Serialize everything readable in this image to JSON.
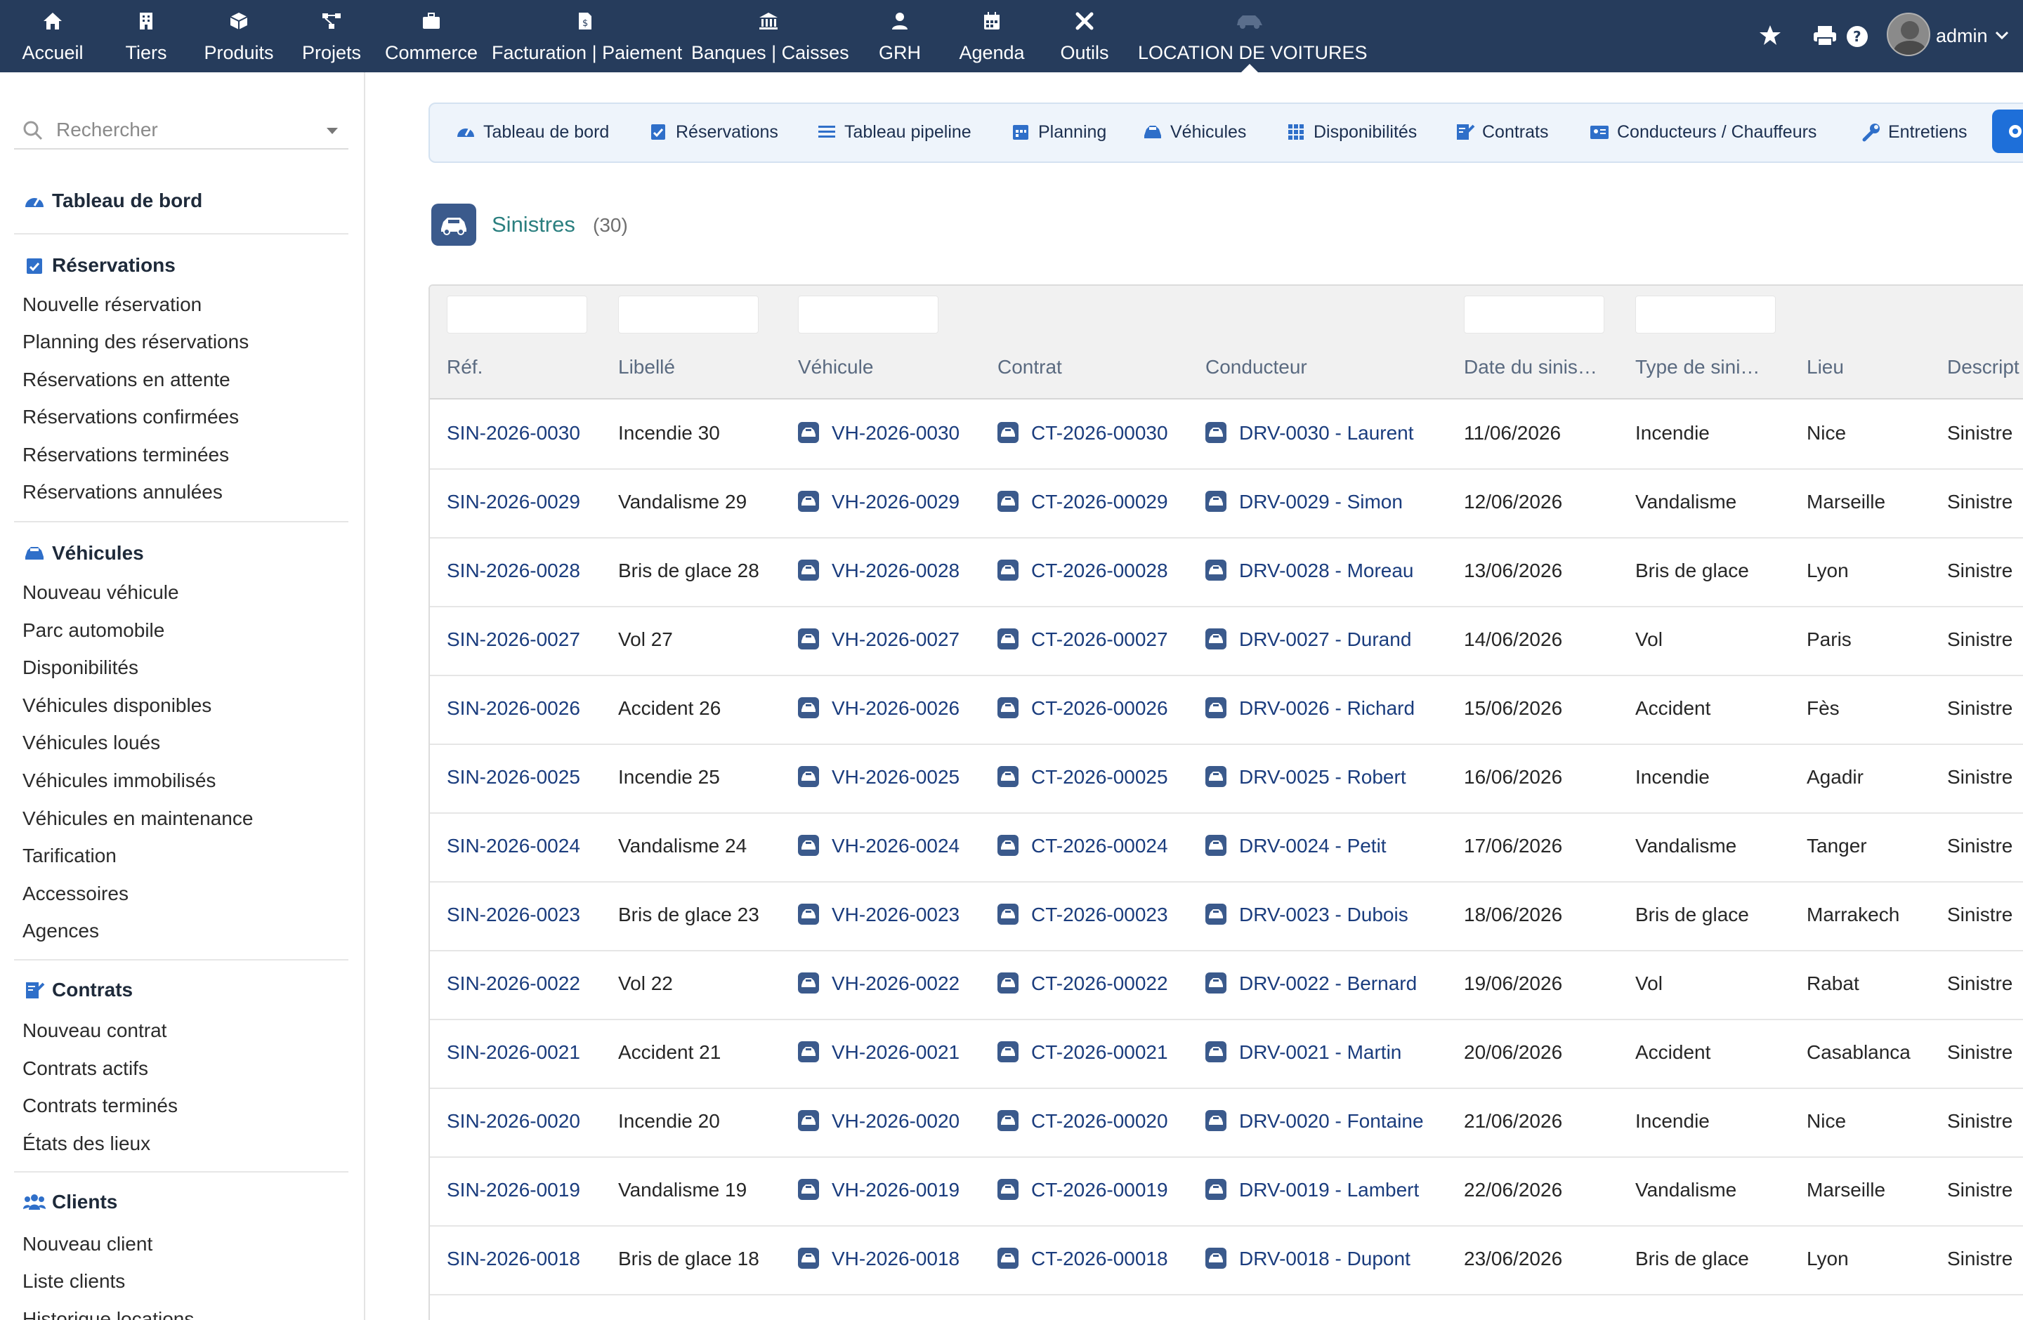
{
  "topmenu": {
    "items": [
      {
        "label": "Accueil",
        "icon": "home-icon"
      },
      {
        "label": "Tiers",
        "icon": "building-icon"
      },
      {
        "label": "Produits",
        "icon": "cube-icon"
      },
      {
        "label": "Projets",
        "icon": "project-icon"
      },
      {
        "label": "Commerce",
        "icon": "briefcase-icon"
      },
      {
        "label": "Facturation | Paiement",
        "icon": "invoice-icon"
      },
      {
        "label": "Banques | Caisses",
        "icon": "bank-icon"
      },
      {
        "label": "GRH",
        "icon": "user-tie-icon"
      },
      {
        "label": "Agenda",
        "icon": "calendar-icon"
      },
      {
        "label": "Outils",
        "icon": "tools-icon"
      },
      {
        "label": "LOCATION DE VOITURES",
        "icon": "car-icon"
      }
    ],
    "user": "admin"
  },
  "search": {
    "placeholder": "Rechercher"
  },
  "sidebar": {
    "dashboard": "Tableau de bord",
    "reservations": {
      "title": "Réservations",
      "items": [
        "Nouvelle réservation",
        "Planning des réservations",
        "Réservations en attente",
        "Réservations confirmées",
        "Réservations terminées",
        "Réservations annulées"
      ]
    },
    "vehicules": {
      "title": "Véhicules",
      "items": [
        "Nouveau véhicule",
        "Parc automobile",
        "Disponibilités",
        "Véhicules disponibles",
        "Véhicules loués",
        "Véhicules immobilisés",
        "Véhicules en maintenance",
        "Tarification",
        "Accessoires",
        "Agences"
      ]
    },
    "contrats": {
      "title": "Contrats",
      "items": [
        "Nouveau contrat",
        "Contrats actifs",
        "Contrats terminés",
        "États des lieux"
      ]
    },
    "clients": {
      "title": "Clients",
      "items": [
        "Nouveau client",
        "Liste clients",
        "Historique locations"
      ]
    }
  },
  "tabs": [
    "Tableau de bord",
    "Réservations",
    "Tableau pipeline",
    "Planning",
    "Véhicules",
    "Disponibilités",
    "Contrats",
    "Conducteurs / Chauffeurs",
    "Entretiens"
  ],
  "page": {
    "title": "Sinistres",
    "count": "(30)"
  },
  "table": {
    "columns": [
      "Réf.",
      "Libellé",
      "Véhicule",
      "Contrat",
      "Conducteur",
      "Date du sinis…",
      "Type de sini…",
      "Lieu",
      "Descript"
    ],
    "rows": [
      [
        "SIN-2026-0030",
        "Incendie 30",
        "VH-2026-0030",
        "CT-2026-00030",
        "DRV-0030 - Laurent",
        "11/06/2026",
        "Incendie",
        "Nice",
        "Sinistre"
      ],
      [
        "SIN-2026-0029",
        "Vandalisme 29",
        "VH-2026-0029",
        "CT-2026-00029",
        "DRV-0029 - Simon",
        "12/06/2026",
        "Vandalisme",
        "Marseille",
        "Sinistre"
      ],
      [
        "SIN-2026-0028",
        "Bris de glace 28",
        "VH-2026-0028",
        "CT-2026-00028",
        "DRV-0028 - Moreau",
        "13/06/2026",
        "Bris de glace",
        "Lyon",
        "Sinistre"
      ],
      [
        "SIN-2026-0027",
        "Vol 27",
        "VH-2026-0027",
        "CT-2026-00027",
        "DRV-0027 - Durand",
        "14/06/2026",
        "Vol",
        "Paris",
        "Sinistre"
      ],
      [
        "SIN-2026-0026",
        "Accident 26",
        "VH-2026-0026",
        "CT-2026-00026",
        "DRV-0026 - Richard",
        "15/06/2026",
        "Accident",
        "Fès",
        "Sinistre"
      ],
      [
        "SIN-2026-0025",
        "Incendie 25",
        "VH-2026-0025",
        "CT-2026-00025",
        "DRV-0025 - Robert",
        "16/06/2026",
        "Incendie",
        "Agadir",
        "Sinistre"
      ],
      [
        "SIN-2026-0024",
        "Vandalisme 24",
        "VH-2026-0024",
        "CT-2026-00024",
        "DRV-0024 - Petit",
        "17/06/2026",
        "Vandalisme",
        "Tanger",
        "Sinistre"
      ],
      [
        "SIN-2026-0023",
        "Bris de glace 23",
        "VH-2026-0023",
        "CT-2026-00023",
        "DRV-0023 - Dubois",
        "18/06/2026",
        "Bris de glace",
        "Marrakech",
        "Sinistre"
      ],
      [
        "SIN-2026-0022",
        "Vol 22",
        "VH-2026-0022",
        "CT-2026-00022",
        "DRV-0022 - Bernard",
        "19/06/2026",
        "Vol",
        "Rabat",
        "Sinistre"
      ],
      [
        "SIN-2026-0021",
        "Accident 21",
        "VH-2026-0021",
        "CT-2026-00021",
        "DRV-0021 - Martin",
        "20/06/2026",
        "Accident",
        "Casablanca",
        "Sinistre"
      ],
      [
        "SIN-2026-0020",
        "Incendie 20",
        "VH-2026-0020",
        "CT-2026-00020",
        "DRV-0020 - Fontaine",
        "21/06/2026",
        "Incendie",
        "Nice",
        "Sinistre"
      ],
      [
        "SIN-2026-0019",
        "Vandalisme 19",
        "VH-2026-0019",
        "CT-2026-00019",
        "DRV-0019 - Lambert",
        "22/06/2026",
        "Vandalisme",
        "Marseille",
        "Sinistre"
      ],
      [
        "SIN-2026-0018",
        "Bris de glace 18",
        "VH-2026-0018",
        "CT-2026-00018",
        "DRV-0018 - Dupont",
        "23/06/2026",
        "Bris de glace",
        "Lyon",
        "Sinistre"
      ]
    ]
  },
  "colors": {
    "topbar": "#263c5c",
    "link": "#1a3c7d",
    "title": "#2a7f7f",
    "accent": "#1e6fd9"
  }
}
